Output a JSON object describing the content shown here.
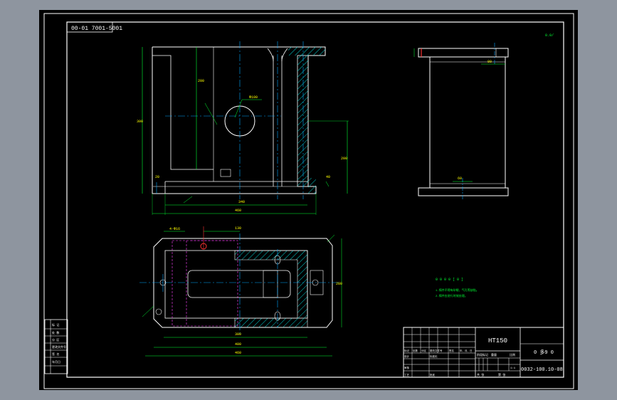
{
  "drawing": {
    "frame_code": "00-01 7001-5001",
    "material": "HT150",
    "part_name": "0 多9 0",
    "drawing_number": "0032-100.10-08",
    "scale_label": "1:1",
    "roughness_note": "0.0/",
    "tech_requirements_title": "0 0 0 0 [ 0 ]",
    "tech_requirements": [
      "1.铸件不得有砂眼、气孔等缺陷。",
      "2.铸件应进行时效处理。"
    ]
  },
  "dimensions": {
    "front_overall_width": "460",
    "front_inner_width": "340",
    "front_height": "300",
    "front_right_height": "200",
    "hole_dia": "Φ100",
    "top_left_height": "200",
    "front_small_1": "20",
    "front_small_2": "40",
    "top_width_1": "300",
    "top_width_2": "400",
    "top_width_3": "460",
    "top_height": "280",
    "top_left_dim": "130",
    "top_hole_label": "4-Φ16",
    "side_top_w": "80",
    "side_bottom_w": "60"
  },
  "left_table": {
    "rows": [
      "标 记",
      "处 数",
      "分 区",
      "更改文件号",
      "签 名",
      "年月日"
    ]
  },
  "title_block": {
    "labels": [
      "标记",
      "处数",
      "分区",
      "更改文件号",
      "签名",
      "年、月、日",
      "设计",
      "标准化",
      "审核",
      "工艺",
      "批准"
    ],
    "stage_labels": [
      "阶段标记",
      "重量",
      "比例"
    ],
    "sheet_labels": [
      "共 张",
      "第 张"
    ]
  },
  "colors": {
    "frame": "#ffffff",
    "geometry": "#ffffff",
    "center": "#00a8ff",
    "dimension": "#00ff33",
    "hatch": "#00cccc",
    "hidden": "#ff44ff",
    "accent": "#ff3333",
    "dim_text": "#ffff00"
  }
}
